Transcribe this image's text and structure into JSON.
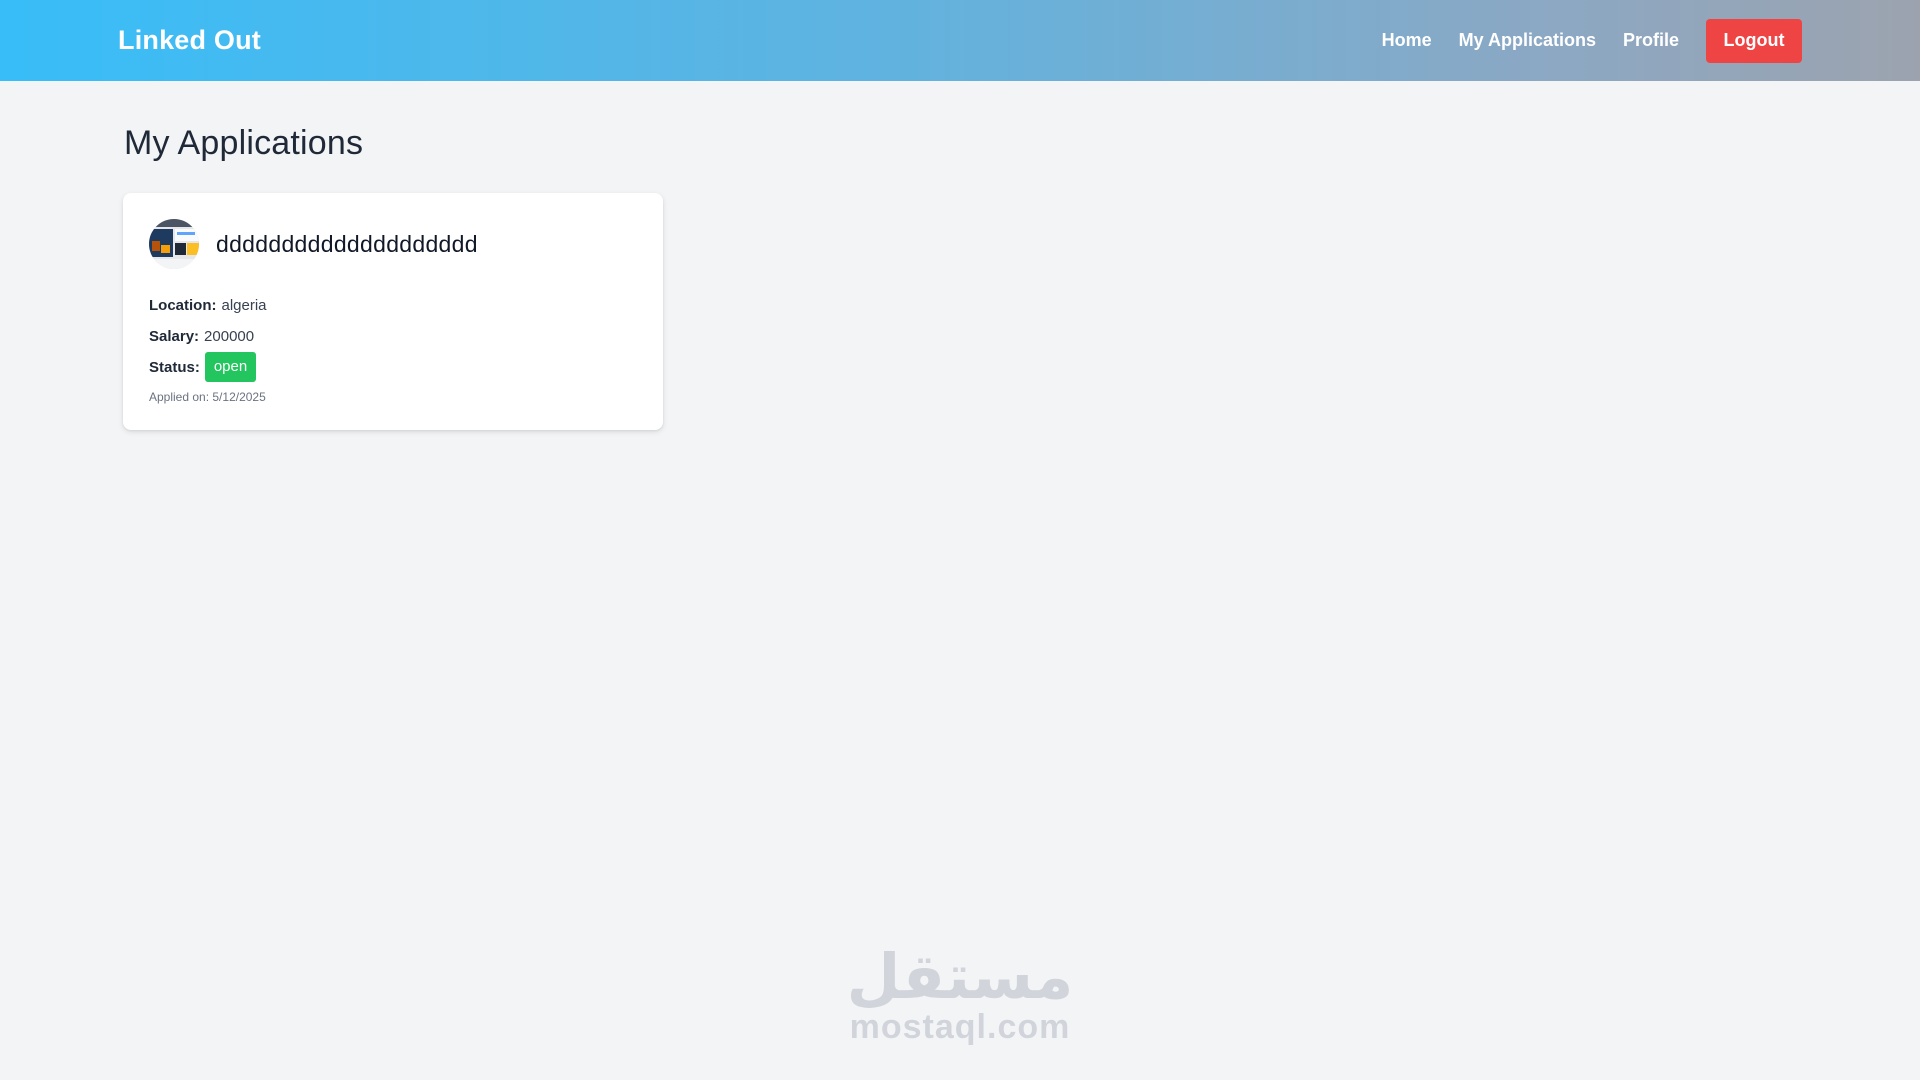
{
  "header": {
    "brand": "Linked Out",
    "nav": {
      "home": "Home",
      "my_applications": "My Applications",
      "profile": "Profile",
      "logout": "Logout"
    }
  },
  "main": {
    "title": "My Applications",
    "applications": [
      {
        "job_title": "dddddddddddddddddddd",
        "location_label": "Location:",
        "location": "algeria",
        "salary_label": "Salary:",
        "salary": "200000",
        "status_label": "Status:",
        "status": "open",
        "applied_on": "Applied on: 5/12/2025"
      }
    ]
  },
  "watermark": {
    "arabic": "مستقل",
    "latin": "mostaql.com"
  },
  "colors": {
    "logout": "#ef4444",
    "status_open": "#22c55e",
    "header_gradient_start": "#38bdf8",
    "header_gradient_end": "#9ca3af"
  }
}
